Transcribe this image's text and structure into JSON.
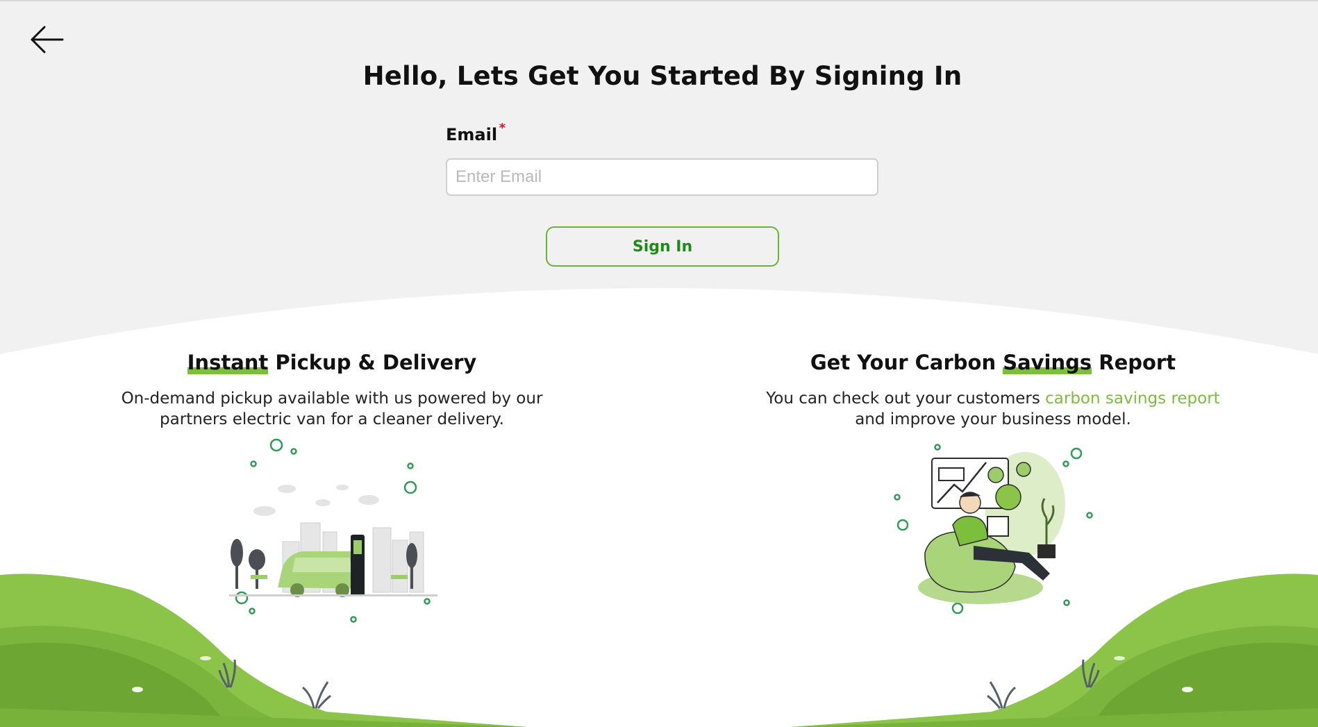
{
  "header": {
    "back_icon": "arrow-left-icon",
    "title": "Hello, Lets Get You Started By Signing In"
  },
  "form": {
    "email_label": "Email",
    "required_mark": "*",
    "email_placeholder": "Enter Email",
    "email_value": "",
    "signin_label": "Sign In"
  },
  "features": [
    {
      "title_highlight": "Instant",
      "title_rest": " Pickup & Delivery",
      "desc_line1": "On-demand pickup available with us powered by our",
      "desc_line2": "partners electric van for a cleaner delivery.",
      "illustration_icon": "electric-van-charging-icon"
    },
    {
      "title_pre": "Get Your Carbon ",
      "title_highlight": "Savings",
      "title_post": " Report",
      "desc_pre": "You can check out your customers ",
      "desc_link": "carbon savings report",
      "desc_line2": "and improve your business model.",
      "illustration_icon": "man-with-laptop-co2-report-icon"
    }
  ],
  "colors": {
    "background": "#f1f1f1",
    "accent_green": "#67b33a",
    "button_text": "#1f8a16",
    "link_green": "#7cbd3f",
    "required_red": "#e11111"
  }
}
